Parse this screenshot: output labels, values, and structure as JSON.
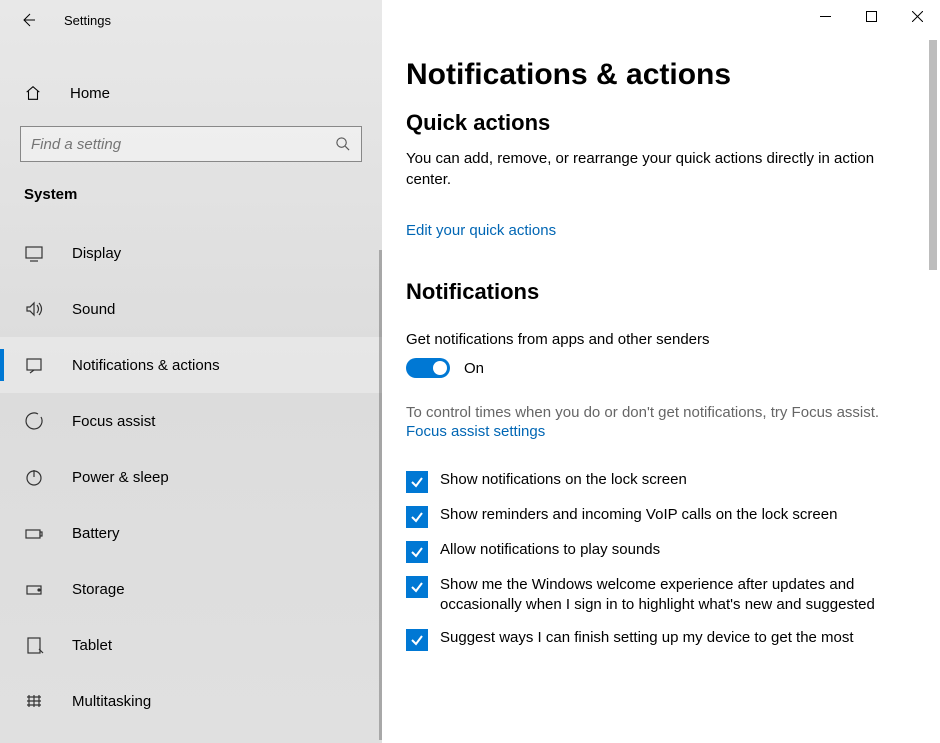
{
  "titlebar": {
    "title": "Settings"
  },
  "sidebar": {
    "home": "Home",
    "search_placeholder": "Find a setting",
    "category": "System",
    "items": [
      {
        "label": "Display"
      },
      {
        "label": "Sound"
      },
      {
        "label": "Notifications & actions"
      },
      {
        "label": "Focus assist"
      },
      {
        "label": "Power & sleep"
      },
      {
        "label": "Battery"
      },
      {
        "label": "Storage"
      },
      {
        "label": "Tablet"
      },
      {
        "label": "Multitasking"
      }
    ]
  },
  "main": {
    "heading": "Notifications & actions",
    "quick": {
      "title": "Quick actions",
      "desc": "You can add, remove, or rearrange your quick actions directly in action center.",
      "link": "Edit your quick actions"
    },
    "notifications": {
      "title": "Notifications",
      "toggle_label": "Get notifications from apps and other senders",
      "toggle_state": "On",
      "focus_hint": "To control times when you do or don't get notifications, try Focus assist.",
      "focus_link": "Focus assist settings",
      "checks": [
        "Show notifications on the lock screen",
        "Show reminders and incoming VoIP calls on the lock screen",
        "Allow notifications to play sounds",
        "Show me the Windows welcome experience after updates and occasionally when I sign in to highlight what's new and suggested",
        "Suggest ways I can finish setting up my device to get the most"
      ]
    }
  }
}
